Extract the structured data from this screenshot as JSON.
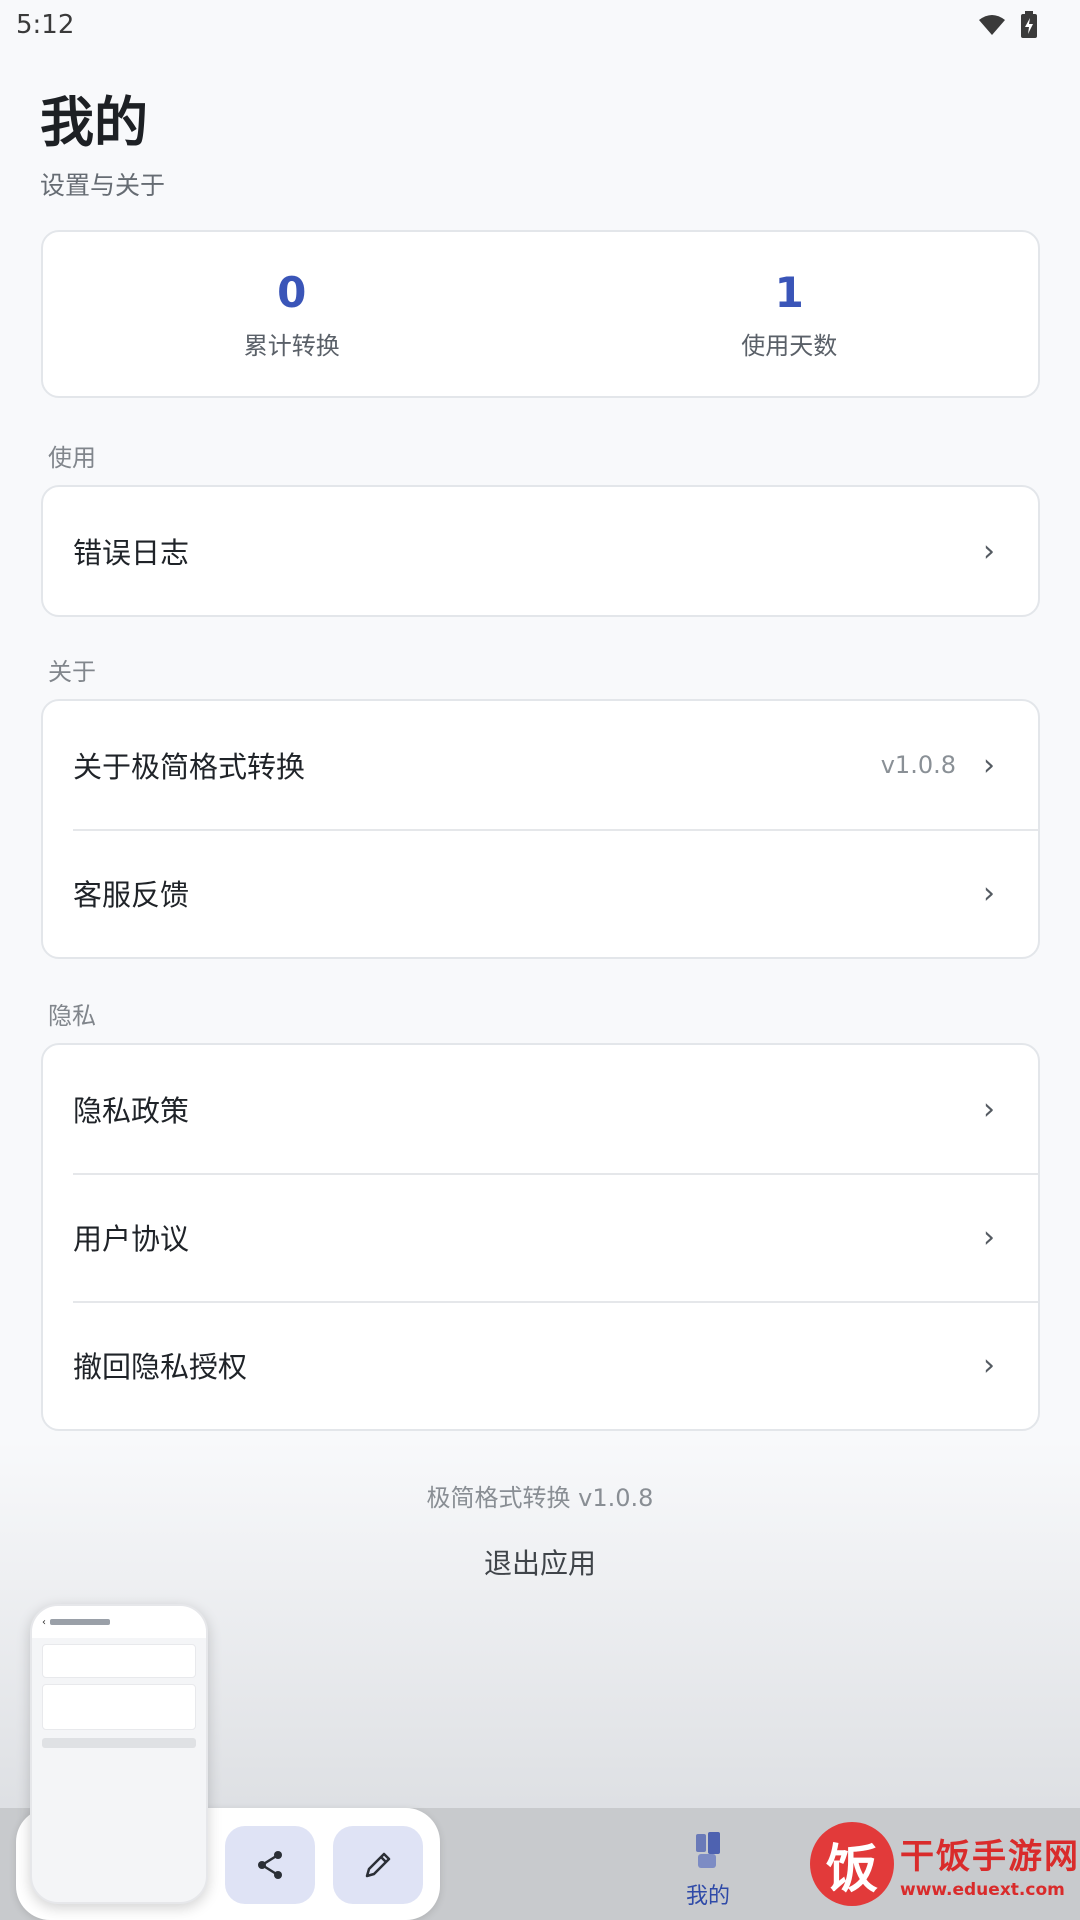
{
  "status_bar": {
    "time": "5:12"
  },
  "header": {
    "title": "我的",
    "subtitle": "设置与关于"
  },
  "stats": [
    {
      "value": "0",
      "label": "累计转换"
    },
    {
      "value": "1",
      "label": "使用天数"
    }
  ],
  "sections": {
    "usage": {
      "title": "使用",
      "items": [
        {
          "label": "错误日志"
        }
      ]
    },
    "about": {
      "title": "关于",
      "items": [
        {
          "label": "关于极简格式转换",
          "value": "v1.0.8"
        },
        {
          "label": "客服反馈"
        }
      ]
    },
    "privacy": {
      "title": "隐私",
      "items": [
        {
          "label": "隐私政策"
        },
        {
          "label": "用户协议"
        },
        {
          "label": "撤回隐私授权"
        }
      ]
    }
  },
  "chevron": "›",
  "footer": {
    "version_text": "极简格式转换 v1.0.8",
    "exit_label": "退出应用"
  },
  "bottom_nav": {
    "mine_label": "我的"
  },
  "watermark": {
    "logo_char": "饭",
    "title": "干饭手游网",
    "url": "www.eduext.com"
  },
  "colors": {
    "accent": "#3a55b8",
    "nav_active": "#2f4aa8",
    "watermark": "#d92b2b"
  }
}
